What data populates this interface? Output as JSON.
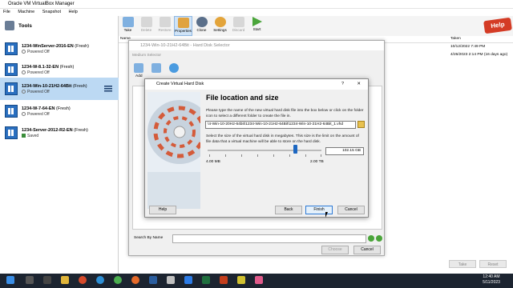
{
  "window": {
    "title": "Oracle VM VirtualBox Manager"
  },
  "menu": [
    "File",
    "Machine",
    "Snapshot",
    "Help"
  ],
  "sidebar": {
    "tools_label": "Tools",
    "vms": [
      {
        "name": "1234-WinServer-2016-EN",
        "tag": "(Fresh)",
        "state": "Powered Off",
        "os": "2016"
      },
      {
        "name": "1234-W-8.1-32-EN",
        "tag": "(Fresh)",
        "state": "Powered Off",
        "os": "8.1"
      },
      {
        "name": "1234-Win-10-21H2-64Bit",
        "tag": "(Fresh)",
        "state": "Powered Off",
        "os": "10"
      },
      {
        "name": "1234-W-7-64-EN",
        "tag": "(Fresh)",
        "state": "Powered Off",
        "os": "7"
      },
      {
        "name": "1234-Server-2012-R2-EN",
        "tag": "(Fresh)",
        "state": "Saved",
        "os": "2012"
      }
    ]
  },
  "toolbar": {
    "items": [
      "Take",
      "Delete",
      "Restore",
      "Properties",
      "Clone",
      "Settings",
      "Discard",
      "Start"
    ]
  },
  "snapshots": {
    "col_name": "Name",
    "col_taken": "Taken",
    "taken_rows": [
      "10/12/2022 7:49 PM",
      "4/26/2023 2:14 PM (16 days ago)"
    ],
    "help_badge": "Help",
    "take_label": "Take",
    "reset_label": "Reset"
  },
  "hd_selector": {
    "title": "1234-Win-10-21H2-64Bit - Hard Disk Selector",
    "toolbar_label": "Medium Selector",
    "add_label": "Add",
    "search_by": "Search By Name",
    "choose_label": "Choose",
    "cancel_label": "Cancel"
  },
  "dialog": {
    "title": "Create Virtual Hard Disk",
    "help_char": "?",
    "heading": "File location and size",
    "para1": "Please type the name of the new virtual hard disk file into the box below or click on the folder icon to select a different folder to create the file in.",
    "path": "\\4-Win-10-20H2-64bit\\1234-Win-10-21H2-64Bit\\1234-Win-10-21H2-64Bit_1.vhd",
    "para2": "Select the size of the virtual hard disk in megabytes. This size is the limit on the amount of file data that a virtual machine will be able to store on the hard disk.",
    "size_value": "102.15 GB",
    "slider_fraction": 0.76,
    "min_label": "4.00 MB",
    "max_label": "2.00 TB",
    "help_btn": "Help",
    "back_btn": "Back",
    "finish_btn": "Finish",
    "cancel_btn": "Cancel"
  },
  "taskbar": {
    "time": "12:40 AM",
    "date": "5/11/2023"
  },
  "colors": {
    "accent": "#1d67c1",
    "selection": "#bcd9f3",
    "taskbar": "#1c2430"
  }
}
